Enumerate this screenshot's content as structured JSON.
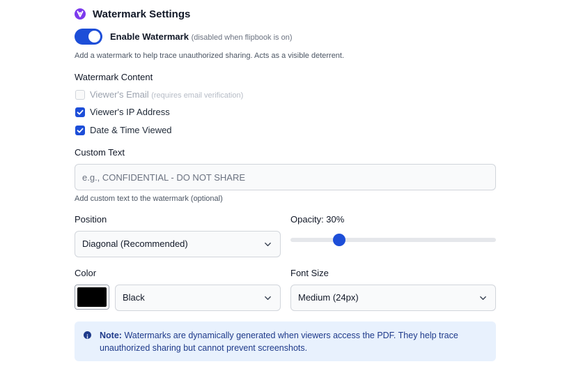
{
  "header": {
    "title": "Watermark Settings",
    "icon": "watermark-logo-icon"
  },
  "toggle": {
    "label": "Enable Watermark",
    "note": "(disabled when flipbook is on)",
    "state": "on",
    "help": "Add a watermark to help trace unauthorized sharing. Acts as a visible deterrent."
  },
  "content": {
    "heading": "Watermark Content",
    "options": [
      {
        "label": "Viewer's Email",
        "note": "(requires email verification)",
        "checked": false,
        "disabled": true
      },
      {
        "label": "Viewer's IP Address",
        "checked": true
      },
      {
        "label": "Date & Time Viewed",
        "checked": true
      }
    ]
  },
  "custom_text": {
    "label": "Custom Text",
    "placeholder": "e.g., CONFIDENTIAL - DO NOT SHARE",
    "help": "Add custom text to the watermark (optional)"
  },
  "position": {
    "label": "Position",
    "value": "Diagonal (Recommended)"
  },
  "opacity": {
    "label": "Opacity: 30%",
    "value": 0.3
  },
  "color": {
    "label": "Color",
    "value": "Black",
    "swatch": "#000000"
  },
  "font_size": {
    "label": "Font Size",
    "value": "Medium (24px)"
  },
  "note": {
    "prefix": "Note:",
    "text": "Watermarks are dynamically generated when viewers access the PDF. They help trace unauthorized sharing but cannot prevent screenshots."
  },
  "colors": {
    "accent": "#1d4ed8",
    "brand": "#7c3aed",
    "note_bg": "#e8f1fd",
    "note_text": "#1e3a8a"
  }
}
